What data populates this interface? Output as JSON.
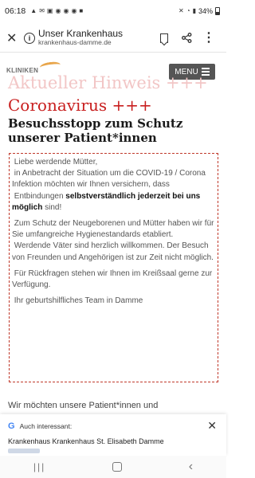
{
  "status_bar": {
    "time": "06:18",
    "battery": "34%"
  },
  "browser": {
    "page_title": "Unser Krankenhaus",
    "url": "krankenhaus-damme.de"
  },
  "site": {
    "logo_text": "KLINIKEN",
    "menu_label": "MENU"
  },
  "article": {
    "ghost_heading": "Aktueller Hinweis +++",
    "heading": "Coronavirus +++",
    "subheading": "Besuchsstopp zum Schutz unserer Patient*innen",
    "notice": {
      "greeting": "Liebe werdende Mütter,",
      "p1_before": "in Anbetracht der Situation um die COVID-19 / Corona Infektion möchten wir Ihnen versichern, dass",
      "p1_lead": "Entbindungen",
      "p1_bold": "selbstverständlich jederzeit bei uns möglich",
      "p1_after": "sind!",
      "p2": "Zum Schutz der Neugeborenen und Mütter haben wir für Sie umfangreiche Hygienestandards etabliert.",
      "p3": "Werdende Väter sind herzlich willkommen. Der Besuch von Freunden und Angehörigen ist zur Zeit nicht möglich.",
      "p4": "Für Rückfragen stehen wir Ihnen im Kreißsaal gerne zur Verfügung.",
      "signature": "Ihr geburtshilfliches Team in Damme"
    },
    "intro_cut": "Wir möchten unsere Patient*innen und"
  },
  "suggestion": {
    "label": "Auch interessant:",
    "title": "Krankenhaus Krankenhaus St. Elisabeth Damme"
  },
  "icons": {
    "close": "close-icon",
    "info": "info-icon",
    "bookmark": "bookmark-icon",
    "share": "share-icon",
    "more": "more-vert-icon",
    "google": "google-icon"
  },
  "colors": {
    "accent_red": "#c81e1e",
    "ghost_red": "#f2c6c6",
    "menu_bg": "#555555",
    "logo_orange": "#e8a54a"
  }
}
